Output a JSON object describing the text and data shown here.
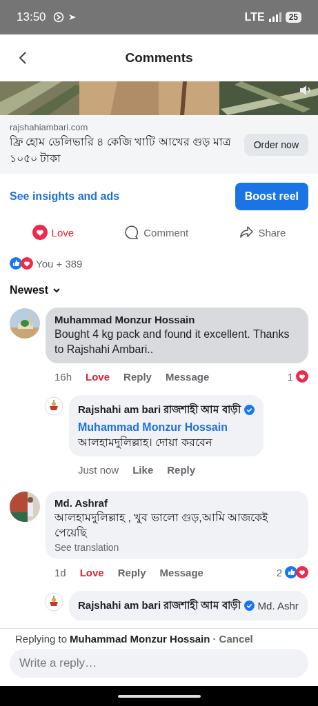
{
  "status_bar": {
    "time": "13:50",
    "network": "LTE",
    "battery": "25"
  },
  "header": {
    "title": "Comments"
  },
  "ad": {
    "domain": "rajshahiambari.com",
    "headline": "ফ্রি হোম ডেলিভারি ৪ কেজি খাটি আখের গুড় মাত্র ১০৫০ টাকা",
    "button": "Order now"
  },
  "insights_link": "See insights and ads",
  "boost_button": "Boost reel",
  "actions": [
    {
      "kind": "love",
      "label": "Love",
      "selected": true
    },
    {
      "kind": "comment",
      "label": "Comment",
      "selected": false
    },
    {
      "kind": "share",
      "label": "Share",
      "selected": false
    }
  ],
  "reactions_summary": {
    "kinds": [
      {
        "kind": "like"
      },
      {
        "kind": "love"
      }
    ],
    "text": "You + 389"
  },
  "sort": "Newest",
  "comments": [
    {
      "author": "Muhammad Monzur Hossain",
      "text": "Bought 4 kg pack and found it excellent. Thanks to Rajshahi Ambari..",
      "time": "16h",
      "actions": [
        {
          "label": "Love",
          "selected": true
        },
        {
          "label": "Reply",
          "selected": false
        },
        {
          "label": "Message",
          "selected": false
        }
      ],
      "reaction_count": "1",
      "reactions": [
        {
          "kind": "love"
        }
      ],
      "replies": [
        {
          "author": "Rajshahi am bari রাজশাহী আম বাড়ী",
          "verified": true,
          "mention": "Muhammad Monzur Hossain",
          "text": "আলহামদুলিল্লাহ। দোয়া করবেন",
          "time": "Just now",
          "actions": [
            {
              "label": "Like",
              "selected": false
            },
            {
              "label": "Reply",
              "selected": false
            }
          ]
        }
      ]
    },
    {
      "author": "Md. Ashraf",
      "text": "আলহামদুলিল্লাহ , খুব ভালো  গুড়,আমি আজকেই পেয়েছি",
      "translation": "See translation",
      "time": "1d",
      "actions": [
        {
          "label": "Love",
          "selected": true
        },
        {
          "label": "Reply",
          "selected": false
        },
        {
          "label": "Message",
          "selected": false
        }
      ],
      "reaction_count": "2",
      "reactions": [
        {
          "kind": "like"
        },
        {
          "kind": "love"
        }
      ],
      "replies": [
        {
          "author": "Rajshahi am bari রাজশাহী আম বাড়ী",
          "verified": true,
          "mention": "Md. Ashr"
        }
      ]
    }
  ],
  "reply_bar": {
    "prefix": "Replying to",
    "name": "Muhammad Monzur Hossain",
    "cancel": "· Cancel",
    "placeholder": "Write a reply…"
  }
}
